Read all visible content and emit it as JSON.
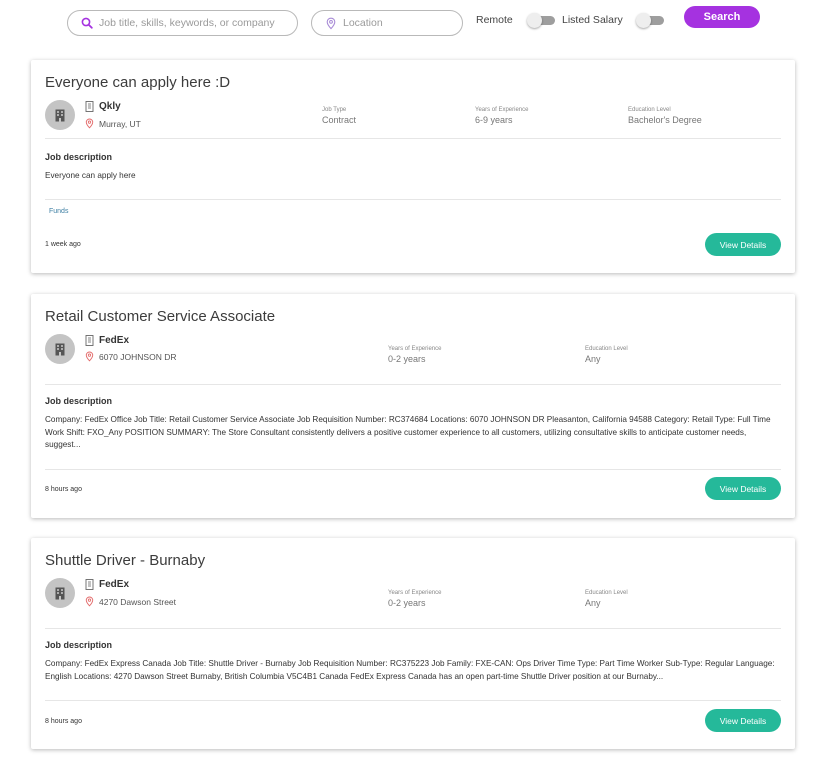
{
  "search": {
    "keywords_placeholder": "Job title, skills, keywords, or company",
    "keywords_value": "",
    "location_placeholder": "Location",
    "location_value": "",
    "remote_label": "Remote",
    "remote_on": false,
    "salary_label": "Listed Salary",
    "salary_on": false,
    "button_label": "Search"
  },
  "colors": {
    "accent": "#a532e0",
    "view_button": "#25b99a",
    "location_pin": "#e36b6b",
    "tag_link": "#3d7fa3"
  },
  "icons": {
    "search": "search-icon",
    "location": "location-pin-icon",
    "company": "building-icon",
    "avatar": "office-building-icon"
  },
  "jobs": [
    {
      "title": "Everyone can apply here :D",
      "company": "Qkly",
      "location": "Murray, UT",
      "job_type_label": "Job Type",
      "job_type": "Contract",
      "experience_label": "Years of Experience",
      "experience": "6-9 years",
      "education_label": "Education Level",
      "education": "Bachelor's Degree",
      "description_heading": "Job description",
      "description": "Everyone can apply here",
      "tag": "Funds",
      "posted": "1 week ago",
      "button": "View Details"
    },
    {
      "title": "Retail Customer Service Associate",
      "company": "FedEx",
      "location": "6070 JOHNSON DR",
      "experience_label": "Years of Experience",
      "experience": "0-2 years",
      "education_label": "Education Level",
      "education": "Any",
      "description_heading": "Job description",
      "description": "Company: FedEx Office Job Title: Retail Customer Service Associate Job Requisition Number: RC374684 Locations: 6070 JOHNSON DR Pleasanton, California 94588 Category: Retail Type: Full Time Work Shift: FXO_Any POSITION SUMMARY: The Store Consultant consistently delivers a positive customer experience to all customers, utilizing consultative skills to anticipate customer needs, suggest...",
      "posted": "8 hours ago",
      "button": "View Details"
    },
    {
      "title": "Shuttle Driver - Burnaby",
      "company": "FedEx",
      "location": "4270 Dawson Street",
      "experience_label": "Years of Experience",
      "experience": "0-2 years",
      "education_label": "Education Level",
      "education": "Any",
      "description_heading": "Job description",
      "description": "Company: FedEx Express Canada Job Title: Shuttle Driver - Burnaby Job Requisition Number: RC375223 Job Family: FXE-CAN: Ops Driver Time Type: Part Time Worker Sub-Type: Regular Language: English Locations: 4270 Dawson Street Burnaby, British Columbia V5C4B1 Canada FedEx Express Canada has an open part-time Shuttle Driver position at our Burnaby...",
      "posted": "8 hours ago",
      "button": "View Details"
    }
  ]
}
